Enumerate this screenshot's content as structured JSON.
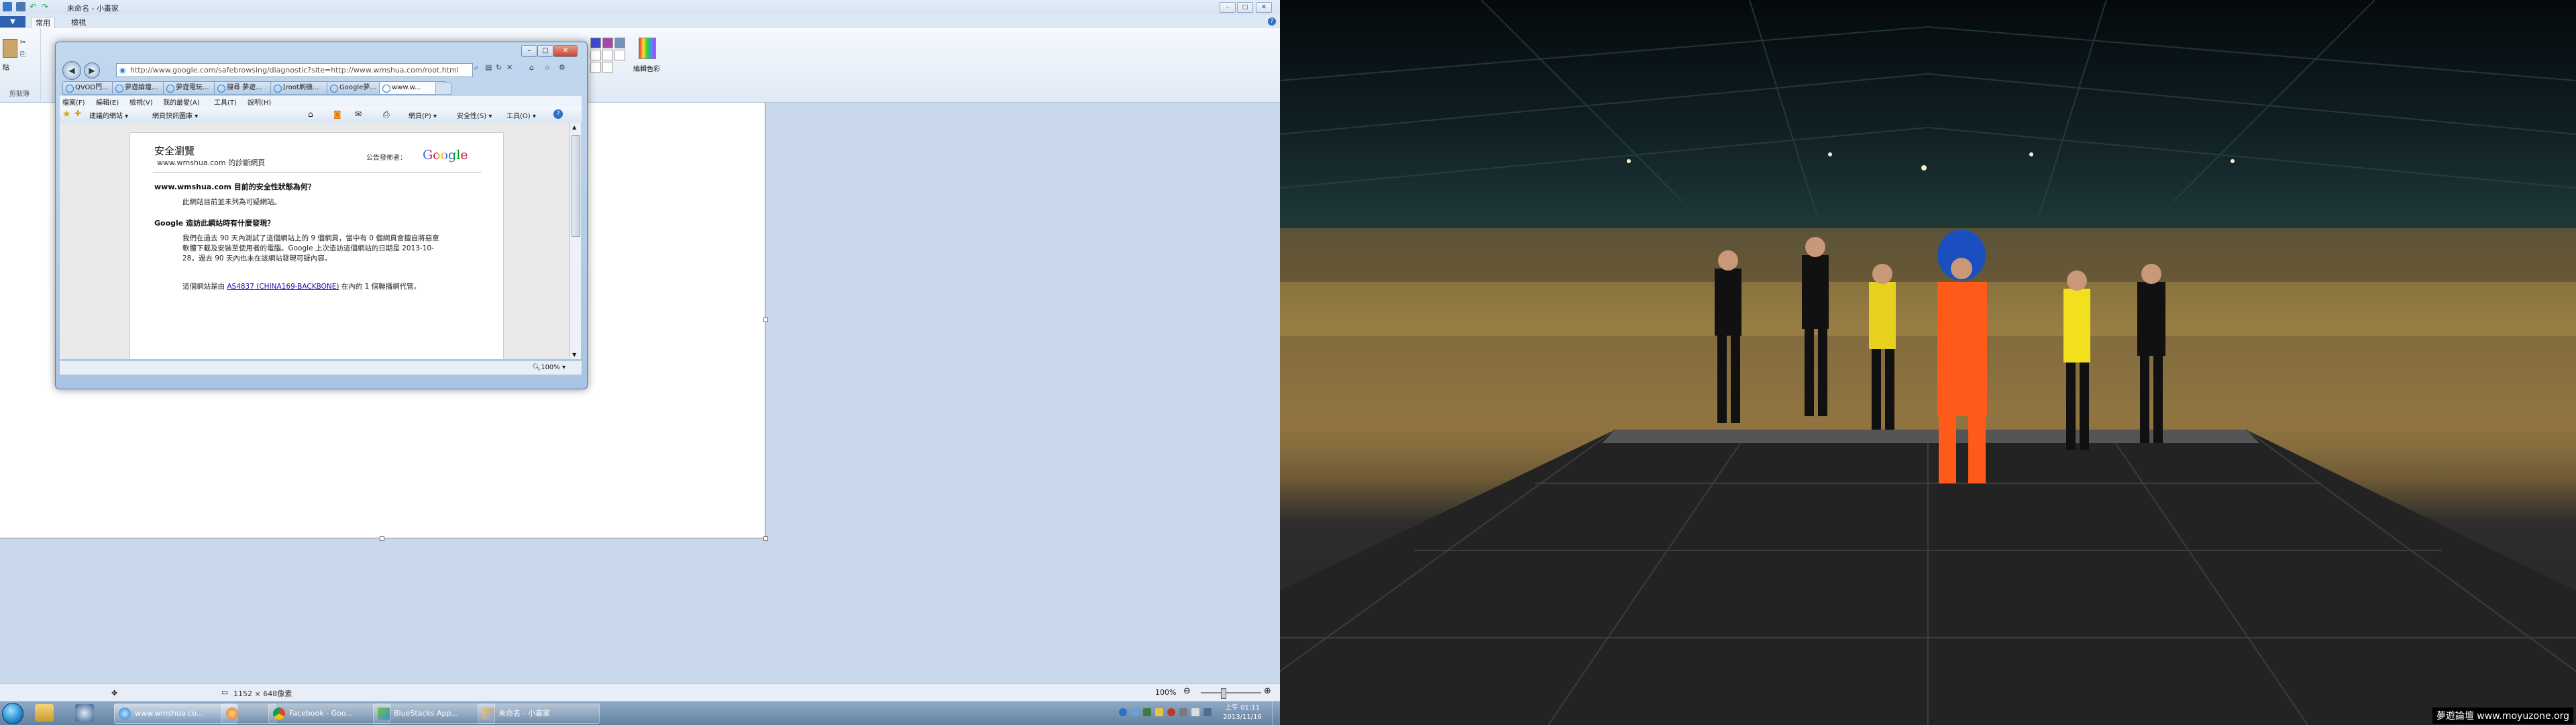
{
  "paint": {
    "title": "未命名 - 小畫家",
    "file_tab": "▼",
    "tab_home": "常用",
    "tab_view": "檢視",
    "group_clipboard": "剪貼簿",
    "paste_label": "貼",
    "edit_colors": "編輯色彩",
    "status_size": "1152 × 648像素",
    "zoom_level": "100%"
  },
  "ie": {
    "address": "http://www.google.com/safebrowsing/diagnostic?site=http://www.wmshua.com/root.html",
    "tabs": [
      "QVOD門...",
      "夢遊論壇...",
      "夢遊電玩...",
      "搜尋 夢遊...",
      "[root刷機...",
      "Google夢...",
      "www.w..."
    ],
    "menu": [
      "檔案(F)",
      "編輯(E)",
      "檢視(V)",
      "我的最愛(A)",
      "工具(T)",
      "說明(H)"
    ],
    "favorites": {
      "suggested": "建議的網站 ▾",
      "gallery": "網頁快訊圖庫 ▾",
      "page": "網頁(P) ▾",
      "safety": "安全性(S) ▾",
      "tools": "工具(O) ▾"
    },
    "zoom": "100%",
    "page": {
      "title": "安全瀏覽",
      "subtitle": "www.wmshua.com 的診斷網頁",
      "ad_label": "公告發佈者：",
      "logo": "Google",
      "q1": "www.wmshua.com 目前的安全性狀態為何？",
      "a1": "此網站目前並未列為可疑網站。",
      "q2": "Google 造訪此網站時有什麼發現？",
      "a2": "我們在過去 90 天內測試了這個網站上的 9 個網頁，當中有 0 個網頁會擅自將惡意軟體下載及安裝至使用者的電腦。Google 上次造訪這個網站的日期是 2013-10-28，過去 90 天內也未在該網站發現可疑內容。",
      "a3_prefix": "這個網站是由",
      "a3_link": "AS4837 (CHINA169-BACKBONE)",
      "a3_suffix": "在內的 1 個聯播網代管。"
    }
  },
  "taskbar": {
    "buttons": [
      "www.wmshua.co...",
      "",
      "Facebook - Goo...",
      "BlueStacks App...",
      "未命名 - 小畫家"
    ],
    "clock_time": "上午 01:11",
    "clock_date": "2013/11/16"
  },
  "wallpaper": {
    "watermark": "夢遊論壇 www.moyuzone.org"
  },
  "colors": {
    "taskbar": "#61809f",
    "ie_frame": "#a8c4e2",
    "link": "#1a0dab"
  }
}
